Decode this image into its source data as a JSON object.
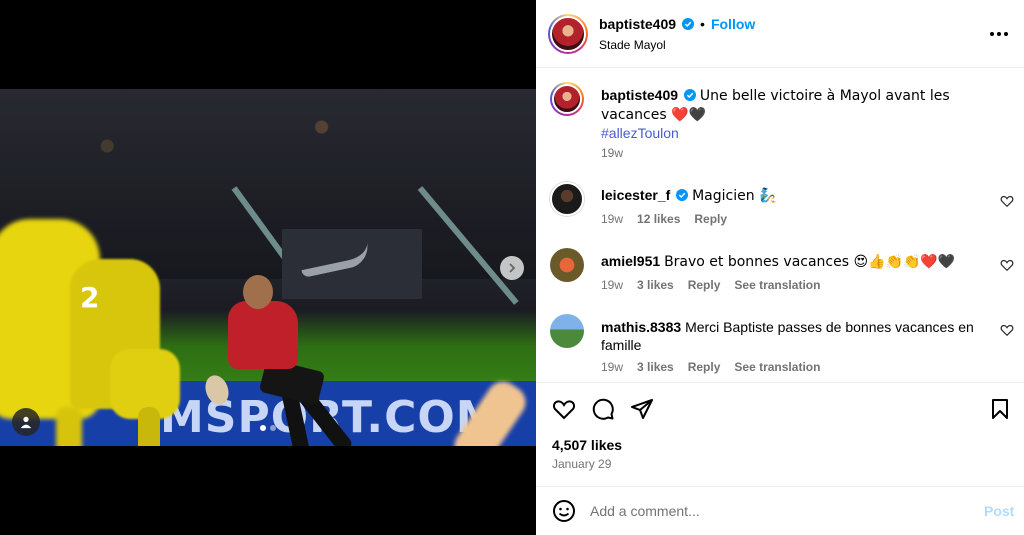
{
  "post": {
    "author": "baptiste409",
    "verified": true,
    "follow_label": "Follow",
    "separator": "•",
    "location": "Stade Mayol",
    "caption": "Une belle victoire à Mayol avant les vacances ❤️🖤",
    "hashtag": "#allezToulon",
    "time": "19w",
    "likes": "4,507 likes",
    "date": "January 29",
    "carousel": {
      "current": 1,
      "total": 2
    },
    "photo_texts": {
      "board": "MSPORT.COM",
      "jersey_number": "2"
    }
  },
  "comments": [
    {
      "username": "leicester_f",
      "verified": true,
      "text": "Magicien 🧞",
      "time": "19w",
      "likes": "12 likes",
      "reply": "Reply",
      "translate": ""
    },
    {
      "username": "amiel951",
      "verified": false,
      "text": "Bravo et bonnes vacances 😍👍👏👏❤️🖤",
      "time": "19w",
      "likes": "3 likes",
      "reply": "Reply",
      "translate": "See translation"
    },
    {
      "username": "mathis.8383",
      "verified": false,
      "text": "Merci Baptiste passes de bonnes vacances en famille",
      "time": "19w",
      "likes": "3 likes",
      "reply": "Reply",
      "translate": "See translation"
    }
  ],
  "composer": {
    "placeholder": "Add a comment...",
    "post_label": "Post"
  },
  "icons": [
    "verified-badge-icon",
    "more-options-icon",
    "heart-icon",
    "comment-icon",
    "share-icon",
    "bookmark-icon",
    "emoji-icon",
    "next-arrow-icon",
    "tagged-user-icon"
  ],
  "colors": {
    "accent": "#0095f6",
    "muted": "#737373",
    "post_disabled": "#b3dbff",
    "hashtag": "#00376b"
  }
}
